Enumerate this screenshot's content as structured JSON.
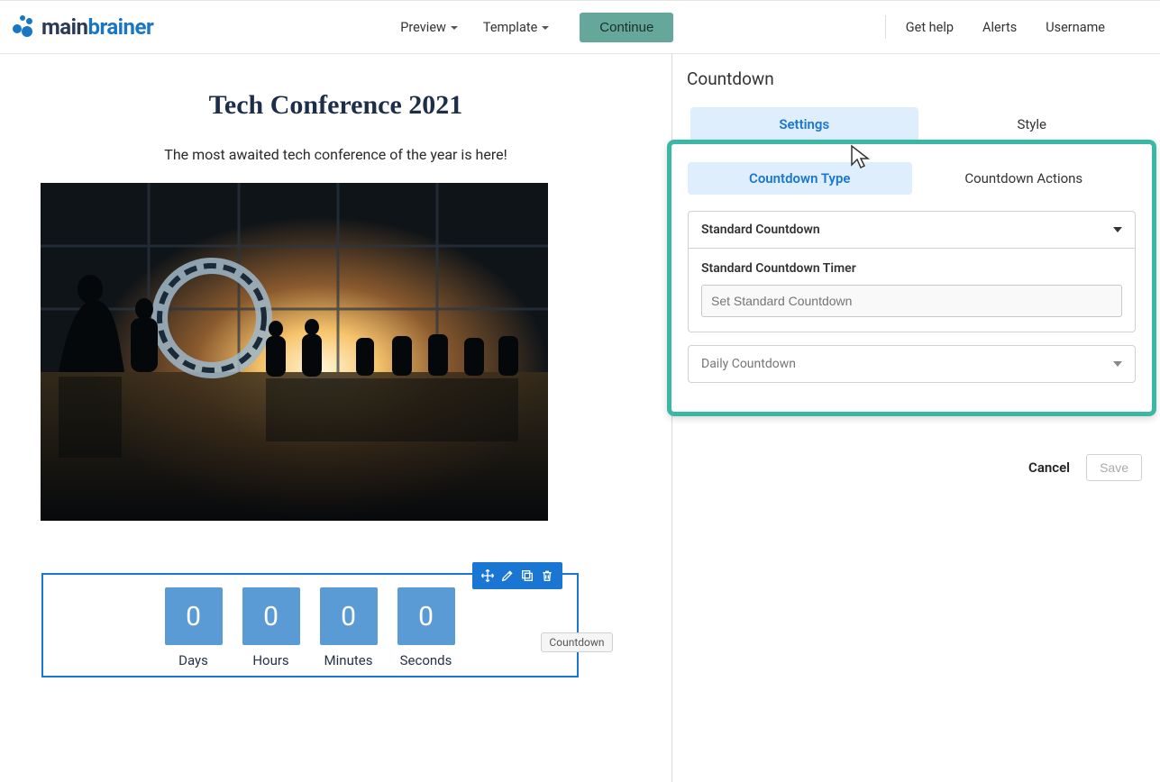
{
  "header": {
    "brand_main": "main",
    "brand_blue": "brainer",
    "preview": "Preview",
    "template": "Template",
    "continue": "Continue",
    "get_help": "Get help",
    "alerts": "Alerts",
    "username": "Username"
  },
  "canvas": {
    "title": "Tech Conference 2021",
    "subtitle": "The most awaited tech conference of the year is here!",
    "countdown": {
      "days_val": "0",
      "days_label": "Days",
      "hours_val": "0",
      "hours_label": "Hours",
      "minutes_val": "0",
      "minutes_label": "Minutes",
      "seconds_val": "0",
      "seconds_label": "Seconds"
    },
    "block_tag": "Countdown"
  },
  "panel": {
    "title": "Countdown",
    "tabs": {
      "settings": "Settings",
      "style": "Style"
    },
    "subtabs": {
      "type": "Countdown Type",
      "actions": "Countdown Actions"
    },
    "accordion1": {
      "title": "Standard Countdown",
      "field_label": "Standard Countdown Timer",
      "placeholder": "Set Standard Countdown"
    },
    "accordion2": {
      "title": "Daily Countdown"
    },
    "cancel": "Cancel",
    "save": "Save"
  }
}
